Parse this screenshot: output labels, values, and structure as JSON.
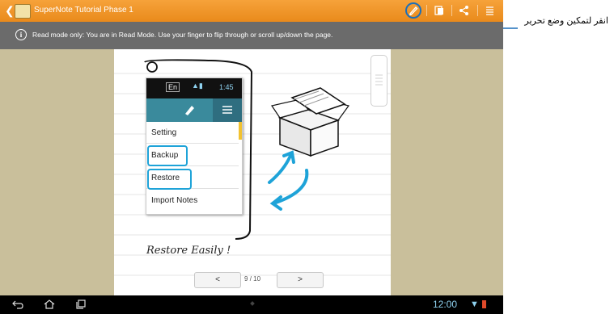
{
  "app": {
    "title": "SuperNote Tutorial Phase 1"
  },
  "info_bar": {
    "text": "Read mode only: You are in Read Mode. Use your finger to flip through or scroll up/down the page."
  },
  "annotation": {
    "text": "انقر لتمكين وضع تحرير"
  },
  "note_page": {
    "phone_status": {
      "lang": "En",
      "time": "1:45"
    },
    "menu_items": [
      {
        "label": "Setting"
      },
      {
        "label": "Backup"
      },
      {
        "label": "Restore"
      },
      {
        "label": "Import Notes"
      }
    ],
    "caption": "Restore Easily !"
  },
  "pager": {
    "prev": "<",
    "next": ">",
    "current": "9",
    "separator": "/",
    "total": "10"
  },
  "system_bar": {
    "time": "12:00"
  },
  "icons": {
    "toolbar": [
      "edit-mode-icon",
      "copy-pages-icon",
      "share-icon",
      "menu-icon"
    ],
    "nav": [
      "back-icon",
      "home-icon",
      "recent-apps-icon"
    ]
  },
  "colors": {
    "toolbar_orange": "#f39a2c",
    "info_bar_gray": "#6b6b6b",
    "background_khaki": "#c9bf9b",
    "highlight_blue": "#1d6fb8",
    "clock_blue": "#8fd2f0"
  }
}
